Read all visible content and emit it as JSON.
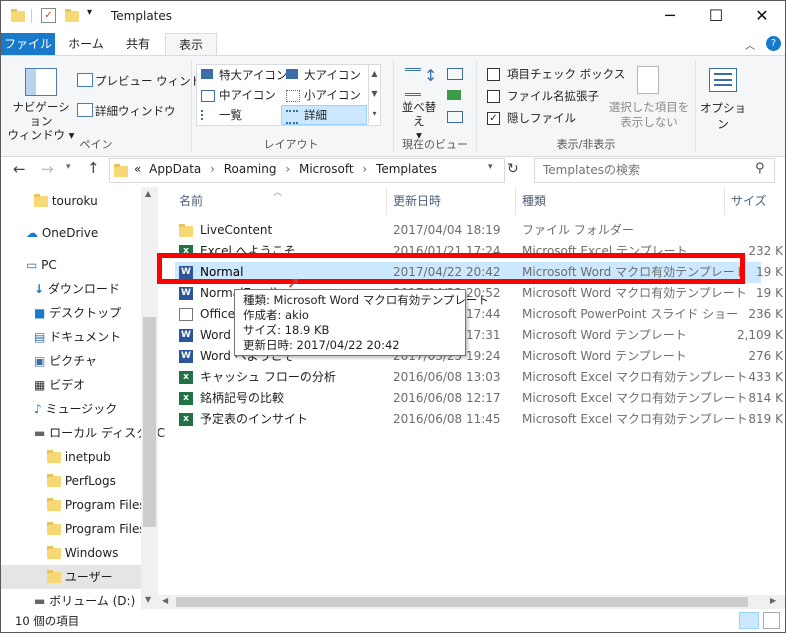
{
  "window": {
    "title": "Templates"
  },
  "tabs": [
    "ファイル",
    "ホーム",
    "共有",
    "表示"
  ],
  "ribbon": {
    "pane": {
      "nav_pane_l1": "ナビゲーション",
      "nav_pane_l2": "ウィンドウ",
      "preview": "プレビュー ウィンドウ",
      "details": "詳細ウィンドウ",
      "group": "ペイン"
    },
    "layout": {
      "xl_icons": "特大アイコン",
      "l_icons": "大アイコン",
      "m_icons": "中アイコン",
      "s_icons": "小アイコン",
      "list": "一覧",
      "details": "詳細",
      "group": "レイアウト"
    },
    "current_view": {
      "sort": "並べ替え",
      "group": "現在のビュー"
    },
    "show_hide": {
      "item_check": "項目チェック ボックス",
      "ext": "ファイル名拡張子",
      "hidden": "隠しファイル",
      "hide_sel_l1": "選択した項目を",
      "hide_sel_l2": "表示しない",
      "group": "表示/非表示"
    },
    "options": "オプション"
  },
  "address": {
    "prefix": "«",
    "path": [
      "AppData",
      "Roaming",
      "Microsoft",
      "Templates"
    ]
  },
  "search": {
    "placeholder": "Templatesの検索"
  },
  "nav": [
    "touroku",
    "OneDrive",
    "PC",
    "ダウンロード",
    "デスクトップ",
    "ドキュメント",
    "ピクチャ",
    "ビデオ",
    "ミュージック",
    "ローカル ディスク (C",
    "inetpub",
    "PerfLogs",
    "Program Files",
    "Program Files (",
    "Windows",
    "ユーザー",
    "ボリューム (D:)"
  ],
  "columns": {
    "name": "名前",
    "date": "更新日時",
    "type": "種類",
    "size": "サイズ"
  },
  "files": [
    {
      "name": "LiveContent",
      "date": "2017/04/04 18:19",
      "type": "ファイル フォルダー",
      "size": ""
    },
    {
      "name": "Excel へようこそ",
      "date": "2016/01/21 17:24",
      "type": "Microsoft Excel テンプレート",
      "size": "232 K"
    },
    {
      "name": "Normal",
      "date": "2017/04/22 20:42",
      "type": "Microsoft Word マクロ有効テンプレート",
      "size": "19 K"
    },
    {
      "name": "NormalEmail",
      "date": "2017/04/22 20:52",
      "type": "Microsoft Word マクロ有効テンプレート",
      "size": "19 K"
    },
    {
      "name": "OfficeTheme",
      "date": "2016/01/21 17:44",
      "type": "Microsoft PowerPoint スライド ショー",
      "size": "236 K"
    },
    {
      "name": "Word へようこそ",
      "date": "2016/01/21 17:31",
      "type": "Microsoft Word テンプレート",
      "size": "2,109 K"
    },
    {
      "name": "Word へようこそ",
      "date": "2017/03/25 19:24",
      "type": "Microsoft Word テンプレート",
      "size": "276 K"
    },
    {
      "name": "キャッシュ フローの分析",
      "date": "2016/06/08 13:03",
      "type": "Microsoft Excel マクロ有効テンプレート",
      "size": "433 K"
    },
    {
      "name": "銘柄記号の比較",
      "date": "2016/06/08 12:17",
      "type": "Microsoft Excel マクロ有効テンプレート",
      "size": "814 K"
    },
    {
      "name": "予定表のインサイト",
      "date": "2016/06/08 11:45",
      "type": "Microsoft Excel マクロ有効テンプレート",
      "size": "819 K"
    }
  ],
  "tooltip": {
    "l1": "種類: Microsoft Word マクロ有効テンプレート",
    "l2": "作成者: akio",
    "l3": "サイズ: 18.9 KB",
    "l4": "更新日時: 2017/04/22 20:42"
  },
  "status": {
    "count": "10 個の項目"
  },
  "colors": {
    "accent": "#1979ca",
    "highlight": "#ff0000",
    "selection": "#cce8ff"
  }
}
